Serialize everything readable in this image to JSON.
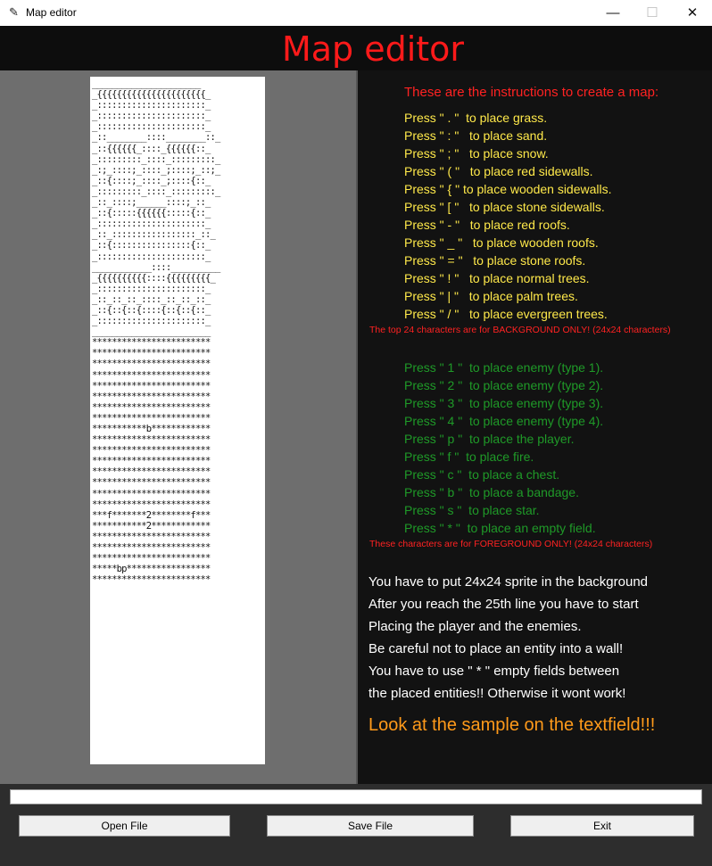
{
  "window": {
    "title": "Map editor",
    "icon": "feather-icon",
    "minimize_glyph": "—",
    "maximize_glyph": "☐",
    "close_glyph": "✕"
  },
  "header": {
    "title": "Map editor"
  },
  "map_text": [
    "______________________",
    "_{{{{{{{{{{{{{{{{{{{{{{_",
    "_::::::::::::::::::::::_",
    "_::::::::::::::::::::::_",
    "_::::::::::::::::::::::_",
    "_::________::::________::_",
    "_::{{{{{{_::::_{{{{{{::_",
    "_:::::::::_::::_:::::::::_",
    "_:;_::::;_::::_;::::;_::;_",
    "_::{::::;_::::_;::::{::_",
    "_:::::::::_::::_:::::::::_",
    "_::_::::;______::::;_::_",
    "_::{:::::{{{{{{:::::{::_",
    "_::::::::::::::::::::::_",
    "_::_:::::::::::::::::_::_",
    "_::{::::::::::::::::{::_",
    "_::::::::::::::::::::::_",
    "____________::::__________",
    "_{{{{{{{{{{::::{{{{{{{{{_",
    "_::::::::::::::::::::::_",
    "_::_::_::_::::_::_::_::_",
    "_::{::{::{::::{::{::{::_",
    "_::::::::::::::::::::::_",
    "________________________",
    "************************",
    "************************",
    "************************",
    "************************",
    "************************",
    "************************",
    "************************",
    "************************",
    "***********b************",
    "************************",
    "************************",
    "************************",
    "************************",
    "************************",
    "************************",
    "************************",
    "***f*******2********f***",
    "***********2************",
    "************************",
    "************************",
    "************************",
    "*****bp*****************",
    "************************"
  ],
  "instructions": {
    "heading": "These are the instructions to create a map:",
    "background_items": [
      "Press \" . \"  to place grass.",
      "Press \" : \"   to place sand.",
      "Press \" ; \"   to place snow.",
      "Press \" ( \"   to place red sidewalls.",
      "Press \" { \" to place wooden sidewalls.",
      "Press \" [ \"   to place stone sidewalls.",
      "Press \" - \"   to place red roofs.",
      "Press \" _ \"   to place wooden roofs.",
      "Press \" = \"   to place stone roofs.",
      "Press \" ! \"   to place normal trees.",
      "Press \" | \"   to place palm trees.",
      "Press \" / \"   to place evergreen trees."
    ],
    "background_note": "The top 24 characters are for BACKGROUND ONLY! (24x24 characters)",
    "foreground_items": [
      "Press \" 1 \"  to place enemy (type 1).",
      "Press \" 2 \"  to place enemy (type 2).",
      "Press \" 3 \"  to place enemy (type 3).",
      "Press \" 4 \"  to place enemy (type 4).",
      "Press \" p \"  to place the player.",
      "Press \" f \"  to place fire.",
      "Press \" c \"  to place a chest.",
      "Press \" b \"  to place a bandage.",
      "Press \" s \"  to place star.",
      "Press \" * \"  to place an empty field."
    ],
    "foreground_note": "These characters are for FOREGROUND ONLY! (24x24 characters)",
    "info_lines": [
      "You have to put 24x24 sprite in the background",
      "After you reach the 25th line you have to start",
      "Placing the player and the enemies.",
      "Be careful not to place an entity into a wall!",
      "You have to use \" * \" empty fields between",
      "the placed entities!! Otherwise it wont work!"
    ],
    "look_text": "Look at the sample on the textfield!!!"
  },
  "filename_input": {
    "value": ""
  },
  "buttons": {
    "open": "Open File",
    "save": "Save File",
    "exit": "Exit"
  },
  "colors": {
    "title_red": "#ff1a1a",
    "instruction_yellow": "#ffe94a",
    "instruction_green": "#1f9a28",
    "note_red": "#ff2222",
    "info_white": "#ffffff",
    "look_orange": "#ff9a1a"
  }
}
